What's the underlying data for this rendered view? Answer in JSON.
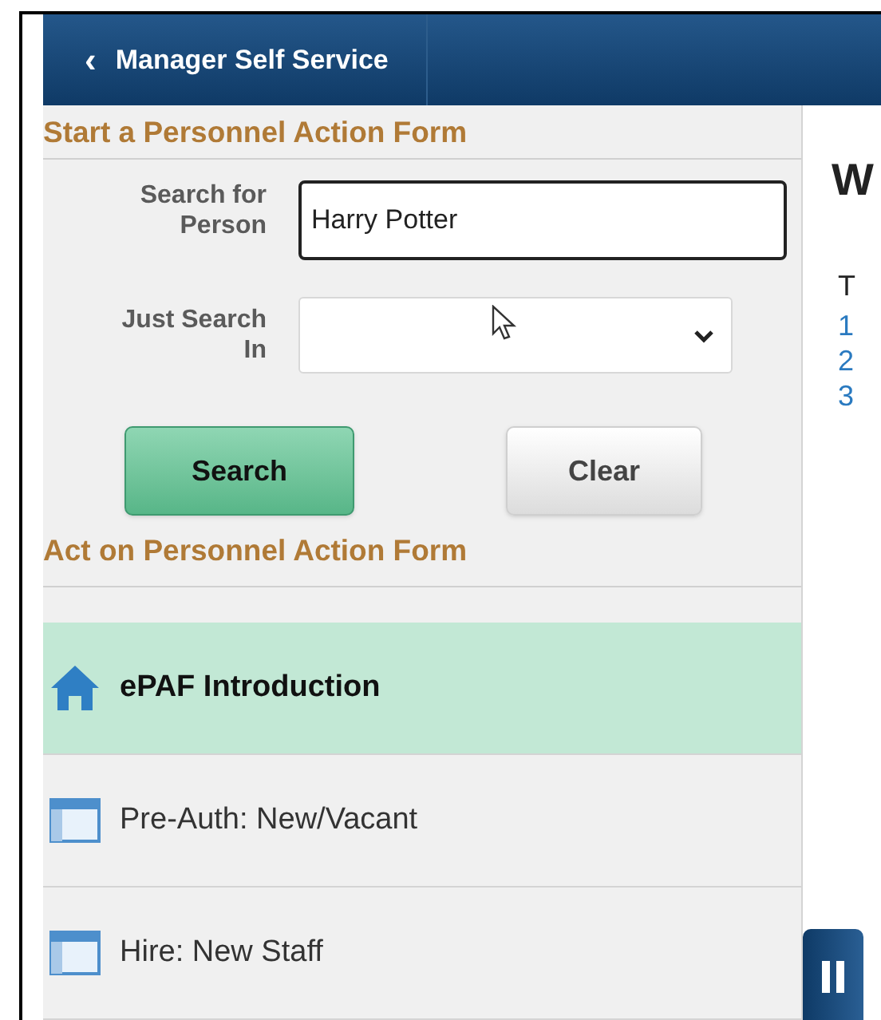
{
  "header": {
    "back_icon": "‹",
    "title": "Manager Self Service"
  },
  "start_section": {
    "heading": "Start a Personnel Action Form",
    "search_field": {
      "label": "Search for Person",
      "value": "Harry Potter"
    },
    "scope_select": {
      "label": "Just Search In"
    },
    "buttons": [
      {
        "label": "Search",
        "kind": "primary"
      },
      {
        "label": "Clear",
        "kind": "secondary"
      }
    ]
  },
  "act_section": {
    "heading": "Act on Personnel Action Form",
    "items": [
      {
        "label": "ePAF Introduction",
        "kind": "home",
        "selected": true
      },
      {
        "label": "Pre-Auth: New/Vacant",
        "kind": "form",
        "selected": false
      },
      {
        "label": "Hire: New Staff",
        "kind": "form",
        "selected": false
      }
    ]
  },
  "content": {
    "heading": "W",
    "text": "T",
    "numbers": [
      "1",
      "2",
      "3"
    ]
  }
}
